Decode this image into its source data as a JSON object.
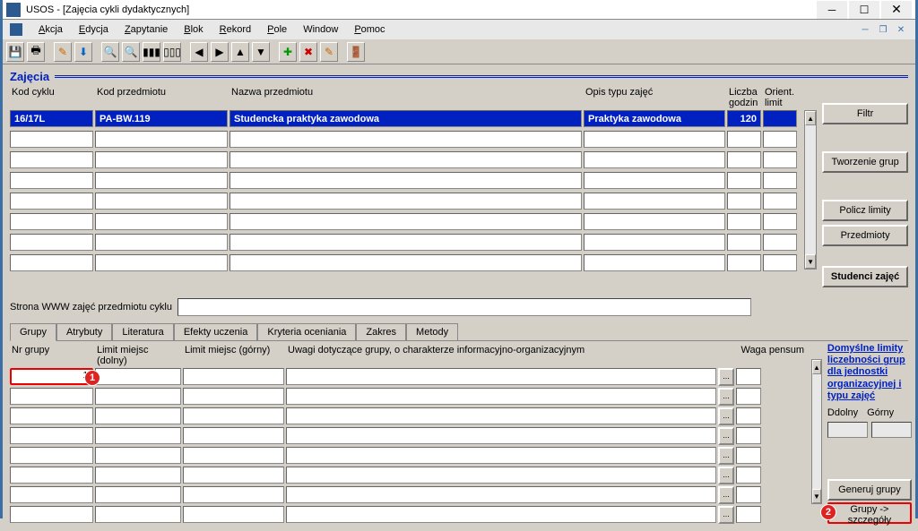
{
  "title": "USOS - [Zajęcia cykli dydaktycznych]",
  "menu": {
    "akcja": "Akcja",
    "edycja": "Edycja",
    "zapytanie": "Zapytanie",
    "blok": "Blok",
    "rekord": "Rekord",
    "pole": "Pole",
    "window": "Window",
    "pomoc": "Pomoc"
  },
  "section_title": "Zajęcia",
  "headers": {
    "kod_cyklu": "Kod cyklu",
    "kod_przedmiotu": "Kod przedmiotu",
    "nazwa_przedmiotu": "Nazwa przedmiotu",
    "opis_typu": "Opis typu zajęć",
    "liczba_godzin": "Liczba\ngodzin",
    "orient_limit": "Orient.\nlimit"
  },
  "rows": [
    {
      "kod_cyklu": "16/17L",
      "kod_przedmiotu": "PA-BW.119",
      "nazwa": "Studencka praktyka zawodowa",
      "opis": "Praktyka zawodowa",
      "godzin": "120",
      "limit": ""
    }
  ],
  "buttons": {
    "filtr": "Filtr",
    "tworzenie_grup": "Tworzenie grup",
    "policz_limity": "Policz limity",
    "przedmioty": "Przedmioty",
    "studenci": "Studenci zajęć",
    "generuj_grupy": "Generuj grupy",
    "grupy_szczegoly": "Grupy -> szczegóły"
  },
  "www_label": "Strona WWW zajęć przedmiotu cyklu",
  "tabs": {
    "grupy": "Grupy",
    "atrybuty": "Atrybuty",
    "literatura": "Literatura",
    "efekty": "Efekty uczenia",
    "kryteria": "Kryteria oceniania",
    "zakres": "Zakres",
    "metody": "Metody"
  },
  "lower_headers": {
    "nr_grupy": "Nr grupy",
    "limit_dolny": "Limit miejsc (dolny)",
    "limit_gorny": "Limit miejsc (górny)",
    "uwagi": "Uwagi dotyczące grupy, o charakterze informacyjno-organizacyjnym",
    "waga": "Waga pensum"
  },
  "lower_rows": [
    {
      "nr": "1",
      "dolny": "",
      "gorny": "",
      "uwagi": "",
      "waga": ""
    }
  ],
  "sidebar": {
    "link_text": "Domyślne limity liczebności grup dla jednostki organizacyjnej i typu zajęć",
    "ddolny": "Ddolny",
    "gorny": "Górny"
  },
  "badges": {
    "one": "1",
    "two": "2"
  }
}
